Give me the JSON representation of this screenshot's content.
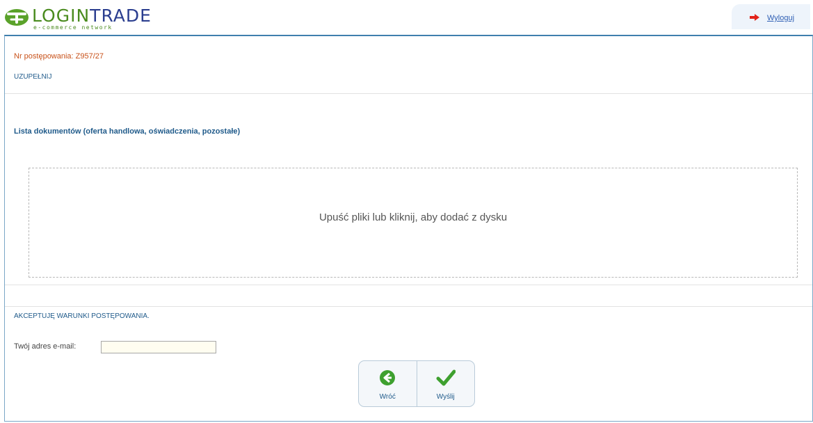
{
  "header": {
    "logo_primary": "LOGIN",
    "logo_secondary": "TRADE",
    "logo_tagline": "e-commerce network",
    "logout_label": "Wyloguj"
  },
  "form": {
    "procedure_number": "Nr postępowania: Z957/27",
    "complete_label": "UZUPEŁNIJ",
    "documents_title": "Lista dokumentów (oferta handlowa, oświadczenia, pozostałe)",
    "dropzone_text": "Upuść pliki lub kliknij, aby dodać z dysku",
    "accept_terms": "AKCEPTUJĘ WARUNKI POSTĘPOWANIA.",
    "email_label": "Twój adres e-mail:",
    "email_value": ""
  },
  "buttons": {
    "back_label": "Wróć",
    "send_label": "Wyślij"
  },
  "colors": {
    "brand_green": "#4a8b1e",
    "brand_blue": "#2b3e8f",
    "accent_red": "#e2231a",
    "label_blue": "#1f5a8a",
    "proc_orange": "#c8521a"
  },
  "icons": {
    "logo": "logintrade-logo-icon",
    "logout": "red-arrow-right-icon",
    "back": "green-circle-arrow-left-icon",
    "send": "green-checkmark-icon"
  }
}
